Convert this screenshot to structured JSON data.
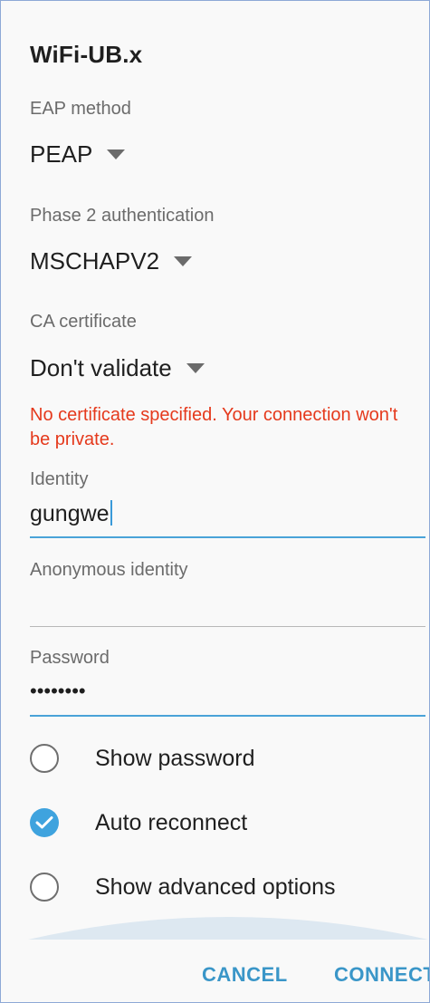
{
  "dialog": {
    "title": "WiFi-UB.x"
  },
  "eap_method": {
    "label": "EAP method",
    "value": "PEAP"
  },
  "phase2": {
    "label": "Phase 2 authentication",
    "value": "MSCHAPV2"
  },
  "ca_certificate": {
    "label": "CA certificate",
    "value": "Don't validate"
  },
  "warning": {
    "text": "No certificate specified. Your connection won't be private."
  },
  "identity": {
    "label": "Identity",
    "value": "gungwe"
  },
  "anonymous_identity": {
    "label": "Anonymous identity",
    "value": ""
  },
  "password": {
    "label": "Password",
    "value": "••••••••"
  },
  "options": [
    {
      "label": "Show password",
      "checked": false
    },
    {
      "label": "Auto reconnect",
      "checked": true
    },
    {
      "label": "Show advanced options",
      "checked": false
    }
  ],
  "buttons": {
    "cancel": "CANCEL",
    "connect": "CONNECT"
  },
  "colors": {
    "accent": "#3fa3de",
    "warning": "#e5391c",
    "button_text": "#3a96c8"
  },
  "icons": {
    "dropdown": "triangle-down-icon",
    "checked": "checkmark-icon"
  }
}
